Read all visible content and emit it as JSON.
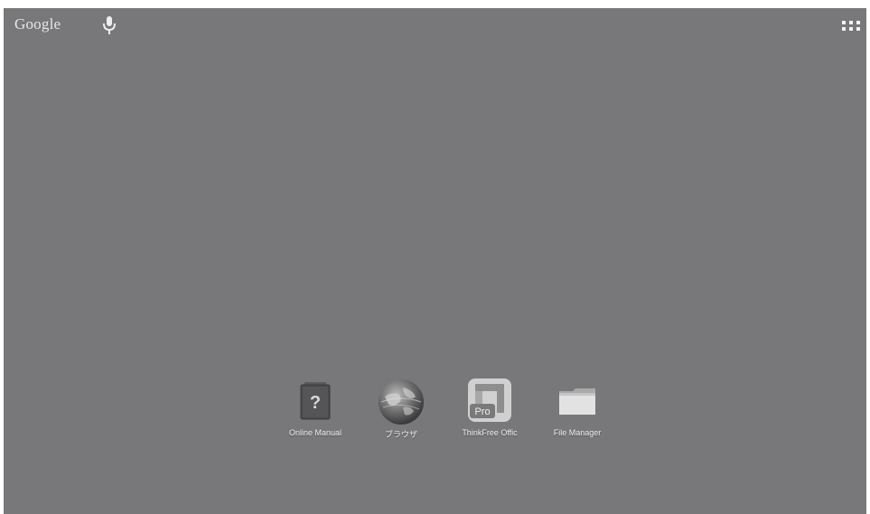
{
  "search_bar": {
    "logo_text": "Google",
    "mic_icon": "microphone-icon"
  },
  "header": {
    "all_apps_icon": "apps-grid-icon"
  },
  "dock": {
    "apps": [
      {
        "label": "Online Manual",
        "icon": "question-book-icon"
      },
      {
        "label": "ブラウザ",
        "icon": "globe-icon"
      },
      {
        "label": "ThinkFree Offic",
        "icon": "thinkfree-office-pro-icon"
      },
      {
        "label": "File Manager",
        "icon": "folder-icon"
      }
    ]
  },
  "colors": {
    "wallpaper": "#78787a",
    "text": "#f0f0f0"
  }
}
